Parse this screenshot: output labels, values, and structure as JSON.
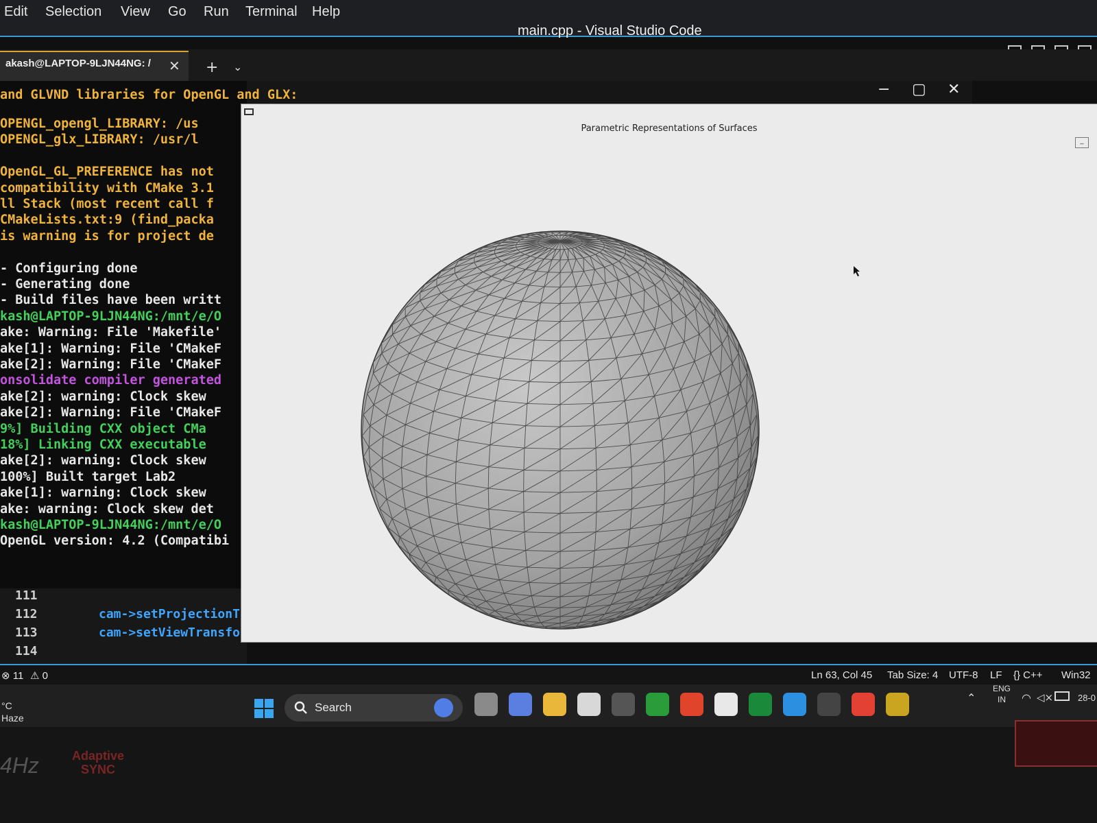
{
  "menubar": {
    "items": [
      "Edit",
      "Selection",
      "View",
      "Go",
      "Run",
      "Terminal",
      "Help"
    ],
    "title": "main.cpp - Visual Studio Code"
  },
  "terminal_tabs": {
    "active_label": "akash@LAPTOP-9LJN44NG: /",
    "close_glyph": "✕",
    "add_glyph": "+",
    "dropdown_glyph": "⌄"
  },
  "terminal": {
    "top_line": "and GLVND libraries for OpenGL and GLX:",
    "lines": [
      {
        "text": "  OPENGL_opengl_LIBRARY: /us",
        "color": "yellow"
      },
      {
        "text": "  OPENGL_glx_LIBRARY: /usr/l",
        "color": "yellow"
      },
      {
        "text": "",
        "color": "yellow"
      },
      {
        "text": "OpenGL_GL_PREFERENCE has not",
        "color": "yellow"
      },
      {
        "text": "compatibility with CMake 3.1",
        "color": "yellow"
      },
      {
        "text": "ll Stack (most recent call f",
        "color": "yellow"
      },
      {
        "text": "CMakeLists.txt:9 (find_packa",
        "color": "yellow"
      },
      {
        "text": "is warning is for project de",
        "color": "yellow"
      },
      {
        "text": "",
        "color": "white"
      },
      {
        "text": "- Configuring done",
        "color": "white"
      },
      {
        "text": "- Generating done",
        "color": "white"
      },
      {
        "text": "- Build files have been writt",
        "color": "white"
      },
      {
        "text": "kash@LAPTOP-9LJN44NG:/mnt/e/O",
        "color": "prompt"
      },
      {
        "text": "ake: Warning: File 'Makefile'",
        "color": "white"
      },
      {
        "text": "ake[1]: Warning: File 'CMakeF",
        "color": "white"
      },
      {
        "text": "ake[2]: Warning: File 'CMakeF",
        "color": "white"
      },
      {
        "text": "onsolidate compiler generated",
        "color": "purple"
      },
      {
        "text": "ake[2]: warning:  Clock skew",
        "color": "white"
      },
      {
        "text": "ake[2]: Warning: File 'CMakeF",
        "color": "white"
      },
      {
        "text": "  9%] Building CXX object CMa",
        "color": "green"
      },
      {
        "text": " 18%] Linking CXX executable",
        "color": "green"
      },
      {
        "text": "ake[2]: warning:  Clock skew",
        "color": "white"
      },
      {
        "text": "100%] Built target Lab2",
        "color": "white"
      },
      {
        "text": "ake[1]: warning:  Clock skew",
        "color": "white"
      },
      {
        "text": "ake: warning:  Clock skew det",
        "color": "white"
      },
      {
        "text": "kash@LAPTOP-9LJN44NG:/mnt/e/O",
        "color": "prompt"
      },
      {
        "text": "OpenGL version: 4.2 (Compatibi",
        "color": "white"
      }
    ]
  },
  "window_controls": {
    "minimize": "−",
    "maximize": "▢",
    "close": "✕"
  },
  "editor": {
    "lines": [
      {
        "num": "111",
        "code": ""
      },
      {
        "num": "112",
        "code": "cam->setProjectionT"
      },
      {
        "num": "113",
        "code": "cam->setViewTransfo"
      },
      {
        "num": "114",
        "code": ""
      }
    ]
  },
  "statusbar": {
    "errors": "⊗ 11",
    "warnings": "⚠ 0",
    "position": "Ln 63, Col 45",
    "tab_size": "Tab Size: 4",
    "encoding": "UTF-8",
    "eol": "LF",
    "language": "{} C++",
    "platform": "Win32"
  },
  "gl_window": {
    "title": "Parametric Representations of Surfaces",
    "sphere": {
      "lat_bands": 28,
      "lon_bands": 34,
      "fill": "#a8a8a8",
      "line": "#3a3a3a"
    }
  },
  "taskbar": {
    "weather_temp": "°C",
    "weather_desc": "Haze",
    "search_label": "Search",
    "apps": [
      "bing-chat-icon",
      "task-view-icon",
      "meet-icon",
      "file-explorer-icon",
      "ms-store-icon",
      "github-desktop-icon",
      "xbox-icon",
      "brave-icon",
      "whatsapp-icon",
      "xbox-game-bar-icon",
      "vscode-icon",
      "terminal-icon",
      "chrome-icon",
      "linux-tux-icon"
    ],
    "tray_lang": "ENG",
    "tray_region": "IN",
    "clock": "28-0"
  },
  "bezel": {
    "refresh": "4Hz",
    "adaptive_line1": "Adaptive",
    "adaptive_line2": "SYNC"
  },
  "colors": {
    "accent": "#3a9ad9",
    "terminal_yellow": "#f0b43c",
    "terminal_green": "#43d15b",
    "terminal_blue": "#3ea6ff",
    "terminal_purple": "#c454e0"
  }
}
